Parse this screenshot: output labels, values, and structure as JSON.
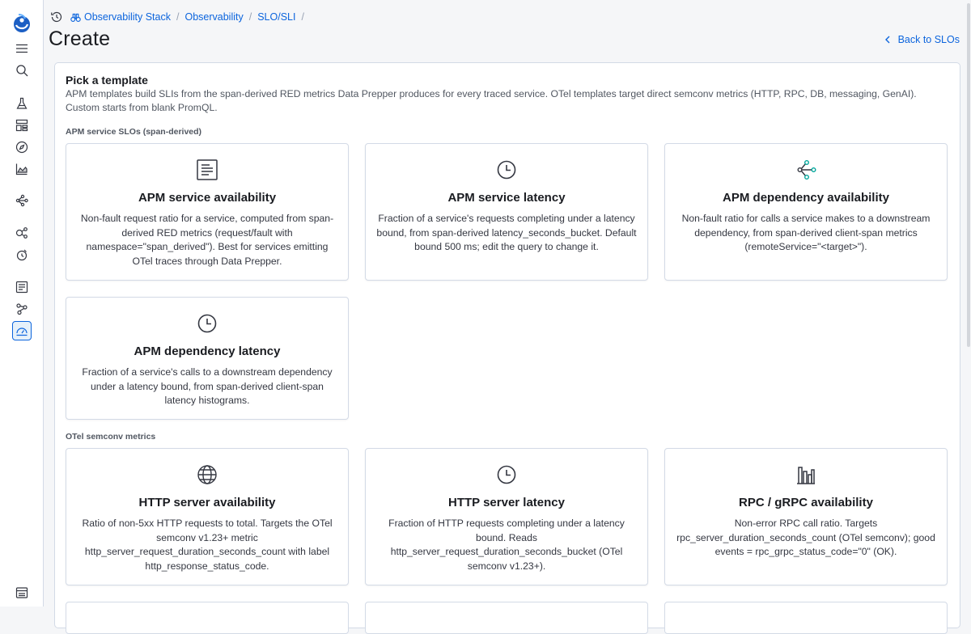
{
  "header": {
    "breadcrumbs": [
      "Observability Stack",
      "Observability",
      "SLO/SLI"
    ],
    "title": "Create",
    "back_link": "Back to SLOs"
  },
  "panel": {
    "title": "Pick a template",
    "description": "APM templates build SLIs from the span-derived RED metrics Data Prepper produces for every traced service. OTel templates target direct semconv metrics (HTTP, RPC, DB, messaging, GenAI). Custom starts from blank PromQL.",
    "sections": [
      {
        "label": "APM service SLOs (span-derived)",
        "cards": [
          {
            "icon": "document-icon",
            "title": "APM service availability",
            "description": "Non-fault request ratio for a service, computed from span-derived RED metrics (request/fault with namespace=\"span_derived\"). Best for services emitting OTel traces through Data Prepper."
          },
          {
            "icon": "clock-icon",
            "title": "APM service latency",
            "description": "Fraction of a service's requests completing under a latency bound, from span-derived latency_seconds_bucket. Default bound 500 ms; edit the query to change it."
          },
          {
            "icon": "dependency-icon",
            "title": "APM dependency availability",
            "description": "Non-fault ratio for calls a service makes to a downstream dependency, from span-derived client-span metrics (remoteService=\"<target>\")."
          },
          {
            "icon": "clock-icon",
            "title": "APM dependency latency",
            "description": "Fraction of a service's calls to a downstream dependency under a latency bound, from span-derived client-span latency histograms."
          }
        ]
      },
      {
        "label": "OTel semconv metrics",
        "cards": [
          {
            "icon": "globe-icon",
            "title": "HTTP server availability",
            "description": "Ratio of non-5xx HTTP requests to total. Targets the OTel semconv v1.23+ metric http_server_request_duration_seconds_count with label http_response_status_code."
          },
          {
            "icon": "clock-icon",
            "title": "HTTP server latency",
            "description": "Fraction of HTTP requests completing under a latency bound. Reads http_server_request_duration_seconds_bucket (OTel semconv v1.23+)."
          },
          {
            "icon": "bar-chart-icon",
            "title": "RPC / gRPC availability",
            "description": "Non-error RPC call ratio. Targets rpc_server_duration_seconds_count (OTel semconv); good events = rpc_grpc_status_code=\"0\" (OK)."
          }
        ]
      }
    ]
  },
  "colors": {
    "accent": "#0b64dd",
    "border": "#d3dae6",
    "background": "#f5f6f8"
  }
}
